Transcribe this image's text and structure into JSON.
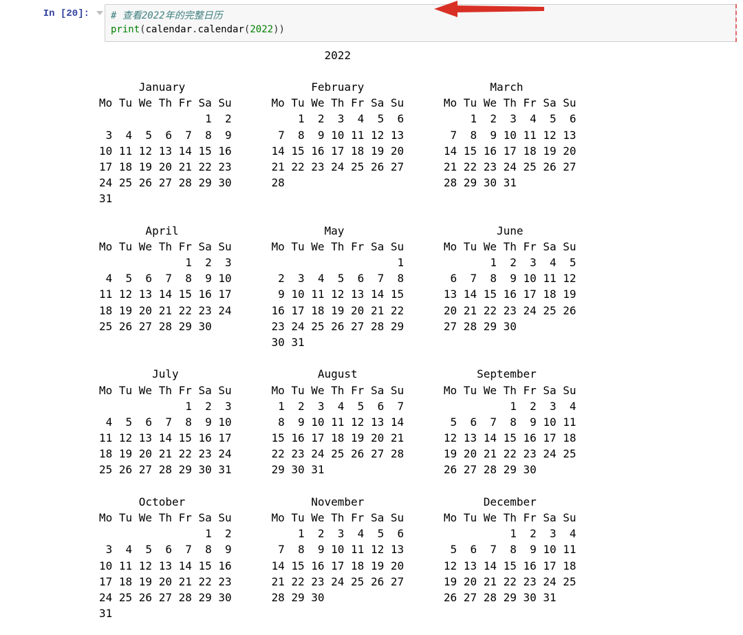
{
  "prompt": {
    "label_prefix": "In ",
    "label_open": "[",
    "exec_count": "20",
    "label_close": "]:"
  },
  "code": {
    "comment": "# 查看2022年的完整日历",
    "builtin": "print",
    "open_paren": "(",
    "mod": "calendar",
    "dot": ".",
    "func": "calendar",
    "open_paren2": "(",
    "arg": "2022",
    "close_paren2": ")",
    "close_paren": ")"
  },
  "calendar_output": "                                  2022\n\n      January                   February                   March\nMo Tu We Th Fr Sa Su      Mo Tu We Th Fr Sa Su      Mo Tu We Th Fr Sa Su\n                1  2          1  2  3  4  5  6          1  2  3  4  5  6\n 3  4  5  6  7  8  9       7  8  9 10 11 12 13       7  8  9 10 11 12 13\n10 11 12 13 14 15 16      14 15 16 17 18 19 20      14 15 16 17 18 19 20\n17 18 19 20 21 22 23      21 22 23 24 25 26 27      21 22 23 24 25 26 27\n24 25 26 27 28 29 30      28                        28 29 30 31\n31\n\n       April                      May                       June\nMo Tu We Th Fr Sa Su      Mo Tu We Th Fr Sa Su      Mo Tu We Th Fr Sa Su\n             1  2  3                         1             1  2  3  4  5\n 4  5  6  7  8  9 10       2  3  4  5  6  7  8       6  7  8  9 10 11 12\n11 12 13 14 15 16 17       9 10 11 12 13 14 15      13 14 15 16 17 18 19\n18 19 20 21 22 23 24      16 17 18 19 20 21 22      20 21 22 23 24 25 26\n25 26 27 28 29 30         23 24 25 26 27 28 29      27 28 29 30\n                          30 31\n\n        July                     August                  September\nMo Tu We Th Fr Sa Su      Mo Tu We Th Fr Sa Su      Mo Tu We Th Fr Sa Su\n             1  2  3       1  2  3  4  5  6  7                1  2  3  4\n 4  5  6  7  8  9 10       8  9 10 11 12 13 14       5  6  7  8  9 10 11\n11 12 13 14 15 16 17      15 16 17 18 19 20 21      12 13 14 15 16 17 18\n18 19 20 21 22 23 24      22 23 24 25 26 27 28      19 20 21 22 23 24 25\n25 26 27 28 29 30 31      29 30 31                  26 27 28 29 30\n\n      October                   November                  December\nMo Tu We Th Fr Sa Su      Mo Tu We Th Fr Sa Su      Mo Tu We Th Fr Sa Su\n                1  2          1  2  3  4  5  6                1  2  3  4\n 3  4  5  6  7  8  9       7  8  9 10 11 12 13       5  6  7  8  9 10 11\n10 11 12 13 14 15 16      14 15 16 17 18 19 20      12 13 14 15 16 17 18\n17 18 19 20 21 22 23      21 22 23 24 25 26 27      19 20 21 22 23 24 25\n24 25 26 27 28 29 30      28 29 30                  26 27 28 29 30 31\n31"
}
